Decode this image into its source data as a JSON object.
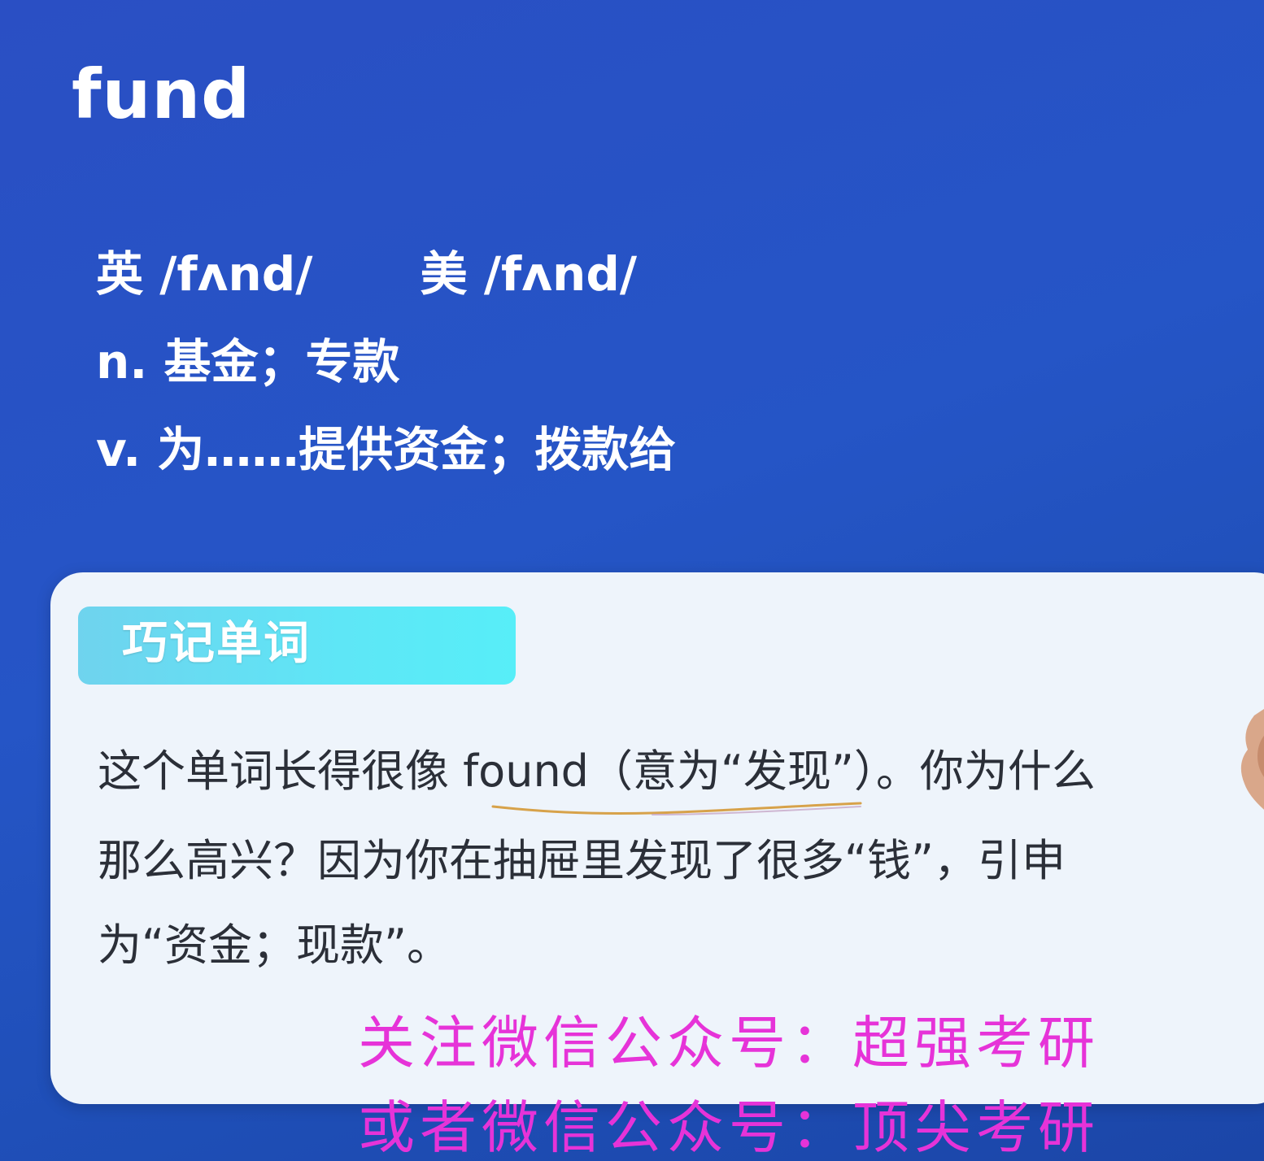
{
  "word": {
    "headword": "fund",
    "pron_uk": "英 /fʌnd/",
    "pron_us": "美 /fʌnd/",
    "def_noun": "n. 基金；专款",
    "def_verb": "v. 为……提供资金；拨款给"
  },
  "card": {
    "tag_label": "巧记单词",
    "line1": "这个单词长得很像 found（意为“发现”）。你为什么",
    "line2": "那么高兴？因为你在抽屉里发现了很多“钱”，引申",
    "line3": "为“资金；现款”。"
  },
  "watermark": {
    "line1": "关注微信公众号：超强考研",
    "line2": "或者微信公众号：顶尖考研"
  },
  "colors": {
    "background": "#2555c6",
    "card": "#eef4fb",
    "tag": "#5ee6f6",
    "watermark": "#e633d8"
  }
}
